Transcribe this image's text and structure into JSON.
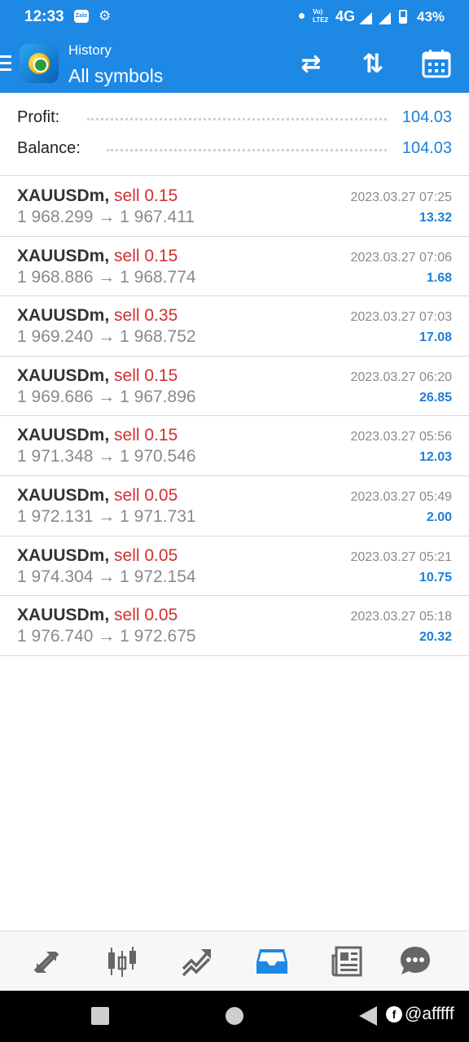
{
  "status_bar": {
    "time": "12:33",
    "zalo_label": "Zalo",
    "volte_label": "Vo) LTE2",
    "network": "4G",
    "battery": "43%"
  },
  "header": {
    "subtitle": "History",
    "title": "All symbols"
  },
  "summary": {
    "profit_label": "Profit:",
    "profit_value": "104.03",
    "balance_label": "Balance:",
    "balance_value": "104.03"
  },
  "trades": [
    {
      "symbol": "XAUUSDm,",
      "side": "sell 0.15",
      "open": "1 968.299",
      "close": "1 967.411",
      "time": "2023.03.27 07:25",
      "profit": "13.32"
    },
    {
      "symbol": "XAUUSDm,",
      "side": "sell 0.15",
      "open": "1 968.886",
      "close": "1 968.774",
      "time": "2023.03.27 07:06",
      "profit": "1.68"
    },
    {
      "symbol": "XAUUSDm,",
      "side": "sell 0.35",
      "open": "1 969.240",
      "close": "1 968.752",
      "time": "2023.03.27 07:03",
      "profit": "17.08"
    },
    {
      "symbol": "XAUUSDm,",
      "side": "sell 0.15",
      "open": "1 969.686",
      "close": "1 967.896",
      "time": "2023.03.27 06:20",
      "profit": "26.85"
    },
    {
      "symbol": "XAUUSDm,",
      "side": "sell 0.15",
      "open": "1 971.348",
      "close": "1 970.546",
      "time": "2023.03.27 05:56",
      "profit": "12.03"
    },
    {
      "symbol": "XAUUSDm,",
      "side": "sell 0.05",
      "open": "1 972.131",
      "close": "1 971.731",
      "time": "2023.03.27 05:49",
      "profit": "2.00"
    },
    {
      "symbol": "XAUUSDm,",
      "side": "sell 0.05",
      "open": "1 974.304",
      "close": "1 972.154",
      "time": "2023.03.27 05:21",
      "profit": "10.75"
    },
    {
      "symbol": "XAUUSDm,",
      "side": "sell 0.05",
      "open": "1 976.740",
      "close": "1 972.675",
      "time": "2023.03.27 05:18",
      "profit": "20.32"
    }
  ],
  "arrow_glyph": "→",
  "bottom_nav": [
    {
      "icon": "quotes-icon",
      "active": false
    },
    {
      "icon": "chart-candles-icon",
      "active": false
    },
    {
      "icon": "trade-icon",
      "active": false
    },
    {
      "icon": "history-inbox-icon",
      "active": true
    },
    {
      "icon": "news-icon",
      "active": false
    },
    {
      "icon": "chat-icon",
      "active": false
    }
  ],
  "watermark": "@afffff",
  "colors": {
    "accent": "#1e88e5",
    "sell": "#d32f2f",
    "profit": "#1e7fd6"
  }
}
